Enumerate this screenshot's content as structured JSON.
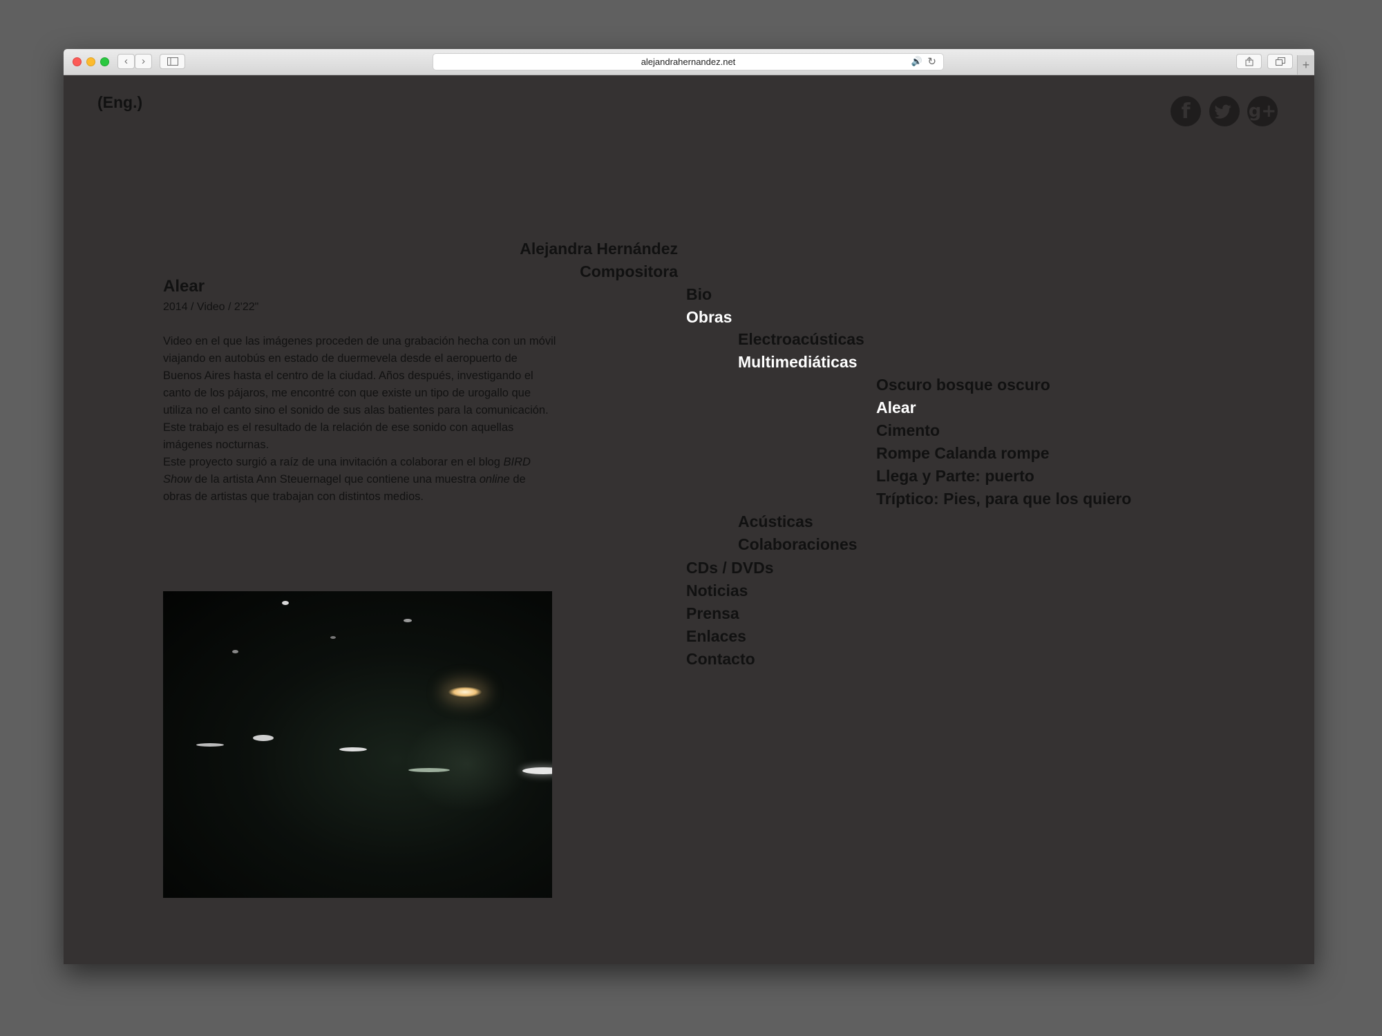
{
  "browser": {
    "url": "alejandrahernandez.net",
    "back_icon": "chevron-left-icon",
    "forward_icon": "chevron-right-icon",
    "sidebar_icon": "sidebar-icon",
    "share_icon": "share-icon",
    "tabs_icon": "tabs-icon",
    "new_tab_icon": "plus-icon",
    "sound_icon": "speaker-icon",
    "reload_icon": "reload-icon"
  },
  "header": {
    "lang_link": "(Eng.)",
    "social": [
      {
        "name": "facebook-icon",
        "glyph": "f"
      },
      {
        "name": "twitter-icon",
        "glyph": "t"
      },
      {
        "name": "google-plus-icon",
        "glyph": "g+"
      }
    ]
  },
  "site": {
    "name": "Alejandra Hernández",
    "role": "Compositora"
  },
  "nav": {
    "bio": "Bio",
    "obras": "Obras",
    "electroacusticas": "Electroacústicas",
    "multimediaticas": "Multimediáticas",
    "works": [
      "Oscuro bosque oscuro",
      "Alear",
      "Cimento",
      "Rompe Calanda rompe",
      "Llega y Parte: puerto",
      "Tríptico: Pies, para que los quiero"
    ],
    "acusticas": "Acústicas",
    "colaboraciones": "Colaboraciones",
    "cds": "CDs / DVDs",
    "noticias": "Noticias",
    "prensa": "Prensa",
    "enlaces": "Enlaces",
    "contacto": "Contacto",
    "active_color": "#ffffff",
    "text_color": "#111111"
  },
  "work": {
    "title": "Alear",
    "meta": "2014 / Video / 2'22\"",
    "desc_p1": "Video en el que las imágenes proceden de una grabación hecha con un móvil viajando en autobús en estado de duermevela desde el aeropuerto de Buenos Aires hasta el centro de la ciudad. Años después, investigando el canto de los pájaros, me encontré con que existe un tipo de urogallo que  utiliza no el canto sino el sonido de sus alas batientes para la comunicación. Este trabajo es el resultado de la relación de ese sonido con aquellas imágenes nocturnas.",
    "desc_p2_a": "Este proyecto surgió a raíz de una invitación a colaborar en el blog ",
    "desc_p2_em1": "BIRD Show",
    "desc_p2_b": " de la artista Ann Steuernagel que contiene una muestra ",
    "desc_p2_em2": "online",
    "desc_p2_c": " de obras de artistas que trabajan con distintos medios."
  },
  "colors": {
    "page_bg": "#353232",
    "desktop_bg": "#606060"
  }
}
